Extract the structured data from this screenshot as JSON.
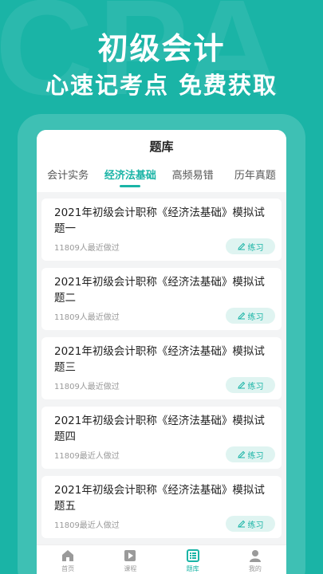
{
  "watermark": "CPA",
  "hero": {
    "title": "初级会计",
    "subtitle": "心速记考点 免费获取"
  },
  "screen": {
    "title": "题库",
    "tabs": [
      {
        "label": "会计实务",
        "active": false
      },
      {
        "label": "经济法基础",
        "active": true
      },
      {
        "label": "高频易错",
        "active": false
      },
      {
        "label": "历年真题",
        "active": false
      }
    ],
    "items": [
      {
        "title": "2021年初级会计职称《经济法基础》模拟试题一",
        "meta": "11809人最近做过",
        "button": "练习"
      },
      {
        "title": "2021年初级会计职称《经济法基础》模拟试题二",
        "meta": "11809人最近做过",
        "button": "练习"
      },
      {
        "title": "2021年初级会计职称《经济法基础》模拟试题三",
        "meta": "11809人最近做过",
        "button": "练习"
      },
      {
        "title": "2021年初级会计职称《经济法基础》模拟试题四",
        "meta": "11809最近人做过",
        "button": "练习"
      },
      {
        "title": "2021年初级会计职称《经济法基础》模拟试题五",
        "meta": "11809最近人做过",
        "button": "练习"
      }
    ],
    "nav": [
      {
        "label": "首页",
        "icon": "home-icon",
        "active": false
      },
      {
        "label": "课程",
        "icon": "play-icon",
        "active": false
      },
      {
        "label": "题库",
        "icon": "question-bank-icon",
        "active": true
      },
      {
        "label": "我的",
        "icon": "user-icon",
        "active": false
      }
    ]
  },
  "colors": {
    "brand": "#1ab4a6",
    "button_bg": "#dff4f1"
  }
}
